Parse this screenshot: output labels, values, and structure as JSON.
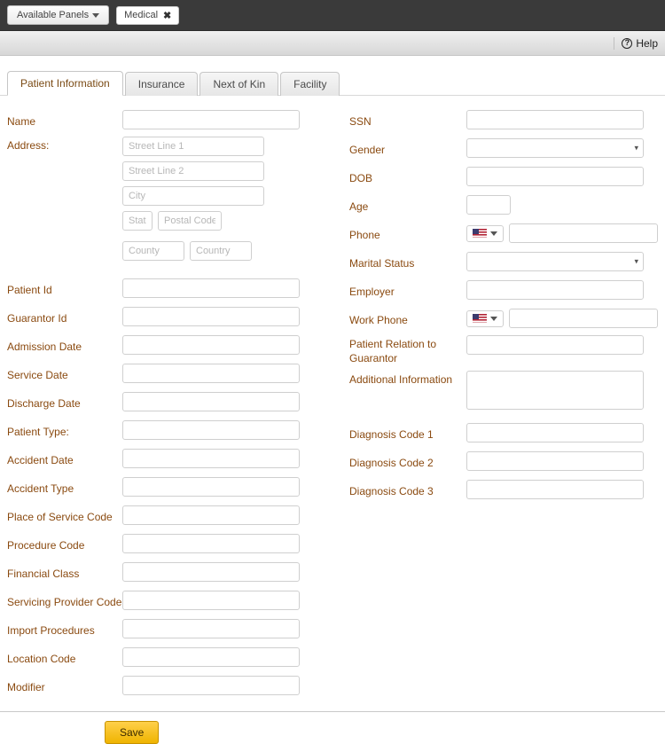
{
  "topbar": {
    "available_panels_label": "Available Panels",
    "open_panel": {
      "label": "Medical",
      "close_glyph": "✖"
    }
  },
  "toolbar": {
    "help_label": "Help"
  },
  "tabs": [
    {
      "id": "patient-info",
      "label": "Patient Information",
      "active": true
    },
    {
      "id": "insurance",
      "label": "Insurance",
      "active": false
    },
    {
      "id": "next-of-kin",
      "label": "Next of Kin",
      "active": false
    },
    {
      "id": "facility",
      "label": "Facility",
      "active": false
    }
  ],
  "left": {
    "name": {
      "label": "Name"
    },
    "address": {
      "label": "Address:",
      "street1_ph": "Street Line 1",
      "street2_ph": "Street Line 2",
      "city_ph": "City",
      "state_ph": "State",
      "postal_ph": "Postal Code",
      "county_ph": "County",
      "country_ph": "Country"
    },
    "patient_id": {
      "label": "Patient Id"
    },
    "guarantor_id": {
      "label": "Guarantor Id"
    },
    "admission_date": {
      "label": "Admission Date"
    },
    "service_date": {
      "label": "Service Date"
    },
    "discharge_date": {
      "label": "Discharge Date"
    },
    "patient_type": {
      "label": "Patient Type:"
    },
    "accident_date": {
      "label": "Accident Date"
    },
    "accident_type": {
      "label": "Accident Type"
    },
    "pos_code": {
      "label": "Place of Service Code"
    },
    "procedure_code": {
      "label": "Procedure Code"
    },
    "financial_class": {
      "label": "Financial Class"
    },
    "servicing_prov": {
      "label": "Servicing Provider Code"
    },
    "import_proc": {
      "label": "Import Procedures"
    },
    "location_code": {
      "label": "Location Code"
    },
    "modifier": {
      "label": "Modifier"
    }
  },
  "right": {
    "ssn": {
      "label": "SSN"
    },
    "gender": {
      "label": "Gender"
    },
    "dob": {
      "label": "DOB"
    },
    "age": {
      "label": "Age"
    },
    "phone": {
      "label": "Phone"
    },
    "marital": {
      "label": "Marital Status"
    },
    "employer": {
      "label": "Employer"
    },
    "work_phone": {
      "label": "Work Phone"
    },
    "relation": {
      "label": "Patient Relation to Guarantor"
    },
    "additional": {
      "label": "Additional Information"
    },
    "dx1": {
      "label": "Diagnosis Code 1"
    },
    "dx2": {
      "label": "Diagnosis Code 2"
    },
    "dx3": {
      "label": "Diagnosis Code 3"
    }
  },
  "footer": {
    "save_label": "Save"
  }
}
